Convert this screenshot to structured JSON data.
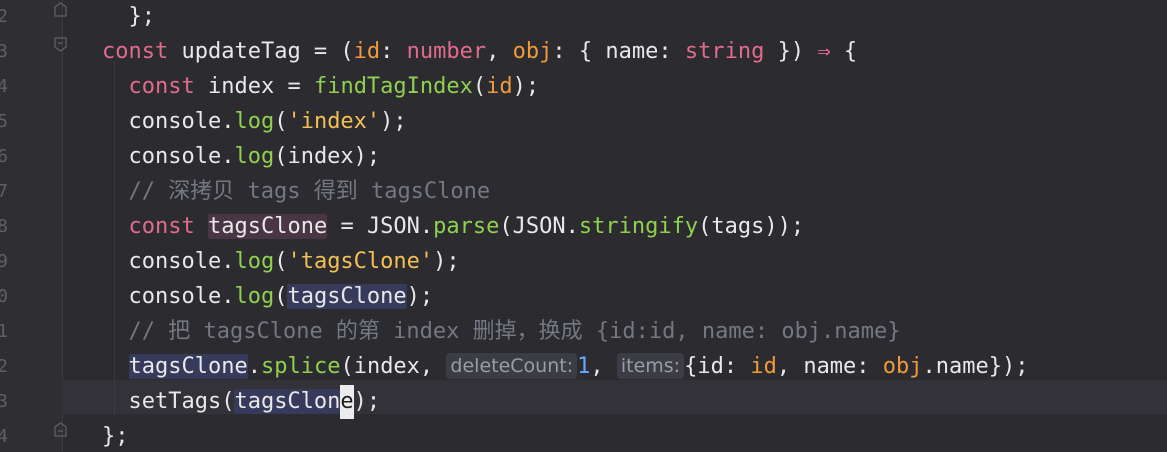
{
  "editor": {
    "line_numbers": [
      "2",
      "3",
      "4",
      "5",
      "6",
      "7",
      "8",
      "9",
      "0",
      "1",
      "2",
      "3",
      "4"
    ],
    "lines": [
      {
        "tokens": [
          [
            "",
            "  };"
          ]
        ]
      },
      {
        "tokens": [
          [
            "kw",
            "const"
          ],
          [
            "",
            " updateTag = ("
          ],
          [
            "param",
            "id"
          ],
          [
            "",
            ": "
          ],
          [
            "type",
            "number"
          ],
          [
            "",
            ", "
          ],
          [
            "param",
            "obj"
          ],
          [
            "",
            ": { "
          ],
          [
            "prop",
            "name"
          ],
          [
            "",
            ": "
          ],
          [
            "type",
            "string"
          ],
          [
            "",
            " }) "
          ],
          [
            "kw",
            "⇒"
          ],
          [
            "",
            " {"
          ]
        ]
      },
      {
        "tokens": [
          [
            "",
            "  "
          ],
          [
            "kw",
            "const"
          ],
          [
            "",
            " index = "
          ],
          [
            "fn",
            "findTagIndex"
          ],
          [
            "",
            "("
          ],
          [
            "param",
            "id"
          ],
          [
            "",
            ");"
          ]
        ]
      },
      {
        "tokens": [
          [
            "",
            "  console."
          ],
          [
            "fn",
            "log"
          ],
          [
            "",
            "("
          ],
          [
            "str",
            "'index'"
          ],
          [
            "",
            ");"
          ]
        ]
      },
      {
        "tokens": [
          [
            "",
            "  console."
          ],
          [
            "fn",
            "log"
          ],
          [
            "",
            "(index);"
          ]
        ]
      },
      {
        "tokens": [
          [
            "",
            "  "
          ],
          [
            "cm",
            "// 深拷贝 tags 得到 tagsClone"
          ]
        ]
      },
      {
        "tokens": [
          [
            "",
            "  "
          ],
          [
            "kw",
            "const"
          ],
          [
            "",
            " "
          ],
          [
            "def",
            "tagsClone"
          ],
          [
            "",
            " = JSON."
          ],
          [
            "fn",
            "parse"
          ],
          [
            "",
            "(JSON."
          ],
          [
            "fn",
            "stringify"
          ],
          [
            "",
            "(tags));"
          ]
        ]
      },
      {
        "tokens": [
          [
            "",
            "  console."
          ],
          [
            "fn",
            "log"
          ],
          [
            "",
            "("
          ],
          [
            "str",
            "'tagsClone'"
          ],
          [
            "",
            ");"
          ]
        ]
      },
      {
        "tokens": [
          [
            "",
            "  console."
          ],
          [
            "fn",
            "log"
          ],
          [
            "",
            "("
          ],
          [
            "use",
            "tagsClone"
          ],
          [
            "",
            ");"
          ]
        ]
      },
      {
        "tokens": [
          [
            "",
            "  "
          ],
          [
            "cm",
            "// 把 tagsClone 的第 index 删掉，换成 {id:id, name: obj.name}"
          ]
        ]
      },
      {
        "tokens": [
          [
            "",
            "  "
          ],
          [
            "use",
            "tagsClone"
          ],
          [
            "",
            "."
          ],
          [
            "fn",
            "splice"
          ],
          [
            "",
            "(index, "
          ],
          [
            "hint",
            "deleteCount:"
          ],
          [
            "num",
            "1"
          ],
          [
            "",
            ", "
          ],
          [
            "hint",
            "items:"
          ],
          [
            "",
            "{id: "
          ],
          [
            "param",
            "id"
          ],
          [
            "",
            ", name: "
          ],
          [
            "param",
            "obj"
          ],
          [
            "",
            ".name});"
          ]
        ]
      },
      {
        "tokens": [
          [
            "",
            "  setTags("
          ],
          [
            "use",
            "tagsClon"
          ],
          [
            "caret",
            "e"
          ],
          [
            "",
            ");"
          ]
        ]
      },
      {
        "tokens": [
          [
            "",
            "};"
          ]
        ]
      }
    ]
  }
}
